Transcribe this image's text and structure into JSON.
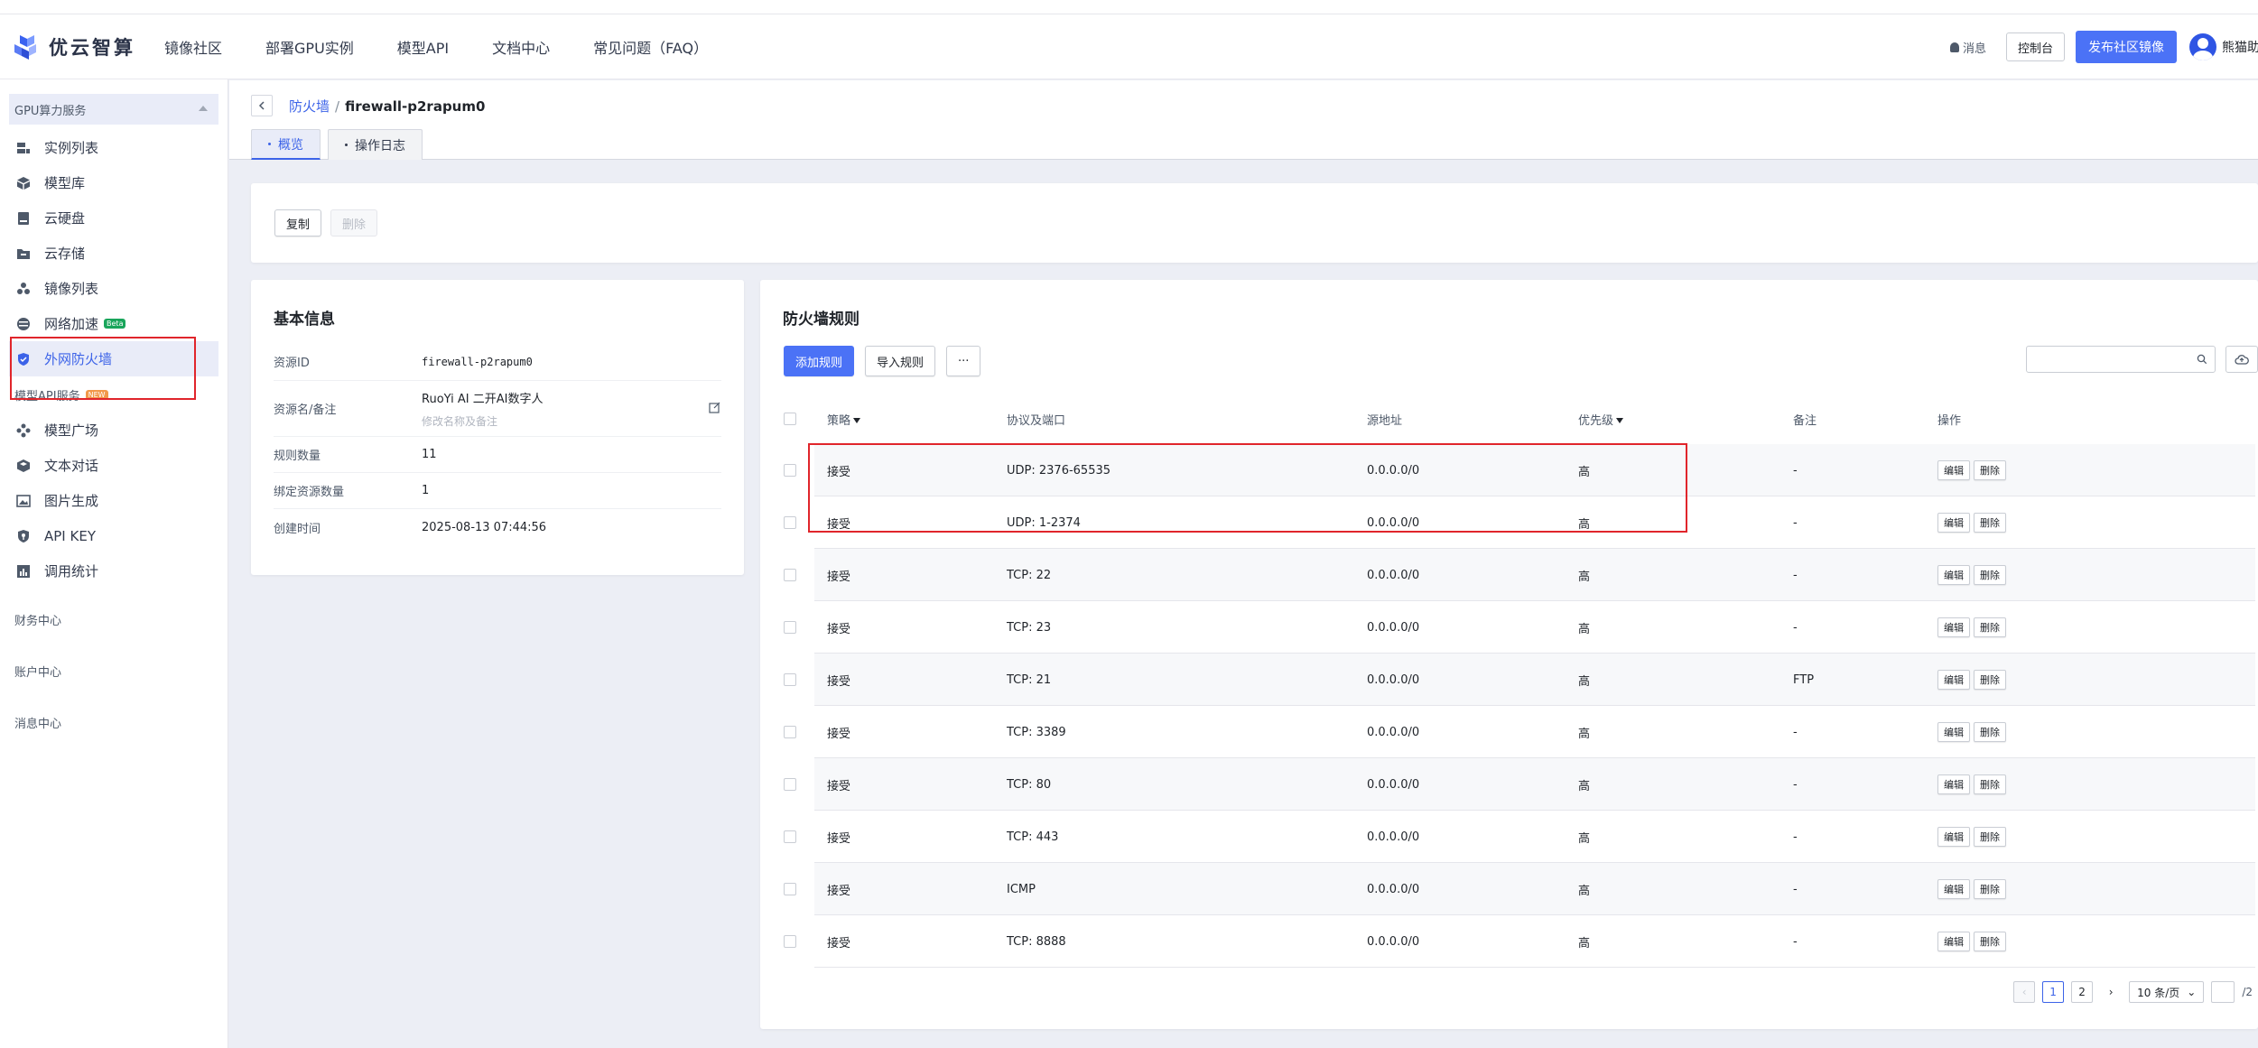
{
  "header": {
    "logo_text": "优云智算",
    "nav": [
      "镜像社区",
      "部署GPU实例",
      "模型API",
      "文档中心",
      "常见问题（FAQ）"
    ],
    "messages_label": "消息",
    "console_label": "控制台",
    "publish_label": "发布社区镜像",
    "username": "熊猫助手"
  },
  "sidebar": {
    "group1_label": "GPU算力服务",
    "group1_items": [
      {
        "label": "实例列表",
        "icon": "server-list-icon"
      },
      {
        "label": "模型库",
        "icon": "model-cube-icon"
      },
      {
        "label": "云硬盘",
        "icon": "disk-icon"
      },
      {
        "label": "云存储",
        "icon": "folder-icon"
      },
      {
        "label": "镜像列表",
        "icon": "image-stack-icon"
      },
      {
        "label": "网络加速",
        "icon": "network-icon",
        "badge": "Beta"
      },
      {
        "label": "外网防火墙",
        "icon": "shield-icon",
        "active": true
      }
    ],
    "group2_label": "模型API服务",
    "group2_badge": "NEW",
    "group2_items": [
      {
        "label": "模型广场",
        "icon": "grid-dots-icon"
      },
      {
        "label": "文本对话",
        "icon": "chat-cube-icon"
      },
      {
        "label": "图片生成",
        "icon": "picture-icon"
      },
      {
        "label": "API KEY",
        "icon": "key-shield-icon"
      },
      {
        "label": "调用统计",
        "icon": "bar-stats-icon"
      }
    ],
    "sections": [
      "财务中心",
      "账户中心",
      "消息中心"
    ]
  },
  "breadcrumb": {
    "parent": "防火墙",
    "separator": "/",
    "current": "firewall-p2rapum0"
  },
  "tabs": [
    "概览",
    "操作日志"
  ],
  "actions": {
    "copy_label": "复制",
    "delete_label": "删除"
  },
  "basic_info": {
    "title": "基本信息",
    "rows": [
      {
        "key": "资源ID",
        "value": "firewall-p2rapum0"
      },
      {
        "key": "资源名/备注",
        "value": "RuoYi AI 二开AI数字人",
        "sub": "修改名称及备注"
      },
      {
        "key": "规则数量",
        "value": "11"
      },
      {
        "key": "绑定资源数量",
        "value": "1"
      },
      {
        "key": "创建时间",
        "value": "2025-08-13 07:44:56"
      }
    ]
  },
  "rules": {
    "title": "防火墙规则",
    "add_label": "添加规则",
    "import_label": "导入规则",
    "more_label": "···",
    "search_placeholder": "",
    "columns": [
      "策略",
      "协议及端口",
      "源地址",
      "优先级",
      "备注",
      "操作"
    ],
    "edit_label": "编辑",
    "delete_label": "删除",
    "rows": [
      {
        "policy": "接受",
        "port": "UDP: 2376-65535",
        "source": "0.0.0.0/0",
        "priority": "高",
        "remark": "-"
      },
      {
        "policy": "接受",
        "port": "UDP: 1-2374",
        "source": "0.0.0.0/0",
        "priority": "高",
        "remark": "-"
      },
      {
        "policy": "接受",
        "port": "TCP: 22",
        "source": "0.0.0.0/0",
        "priority": "高",
        "remark": "-"
      },
      {
        "policy": "接受",
        "port": "TCP: 23",
        "source": "0.0.0.0/0",
        "priority": "高",
        "remark": "-"
      },
      {
        "policy": "接受",
        "port": "TCP: 21",
        "source": "0.0.0.0/0",
        "priority": "高",
        "remark": "FTP"
      },
      {
        "policy": "接受",
        "port": "TCP: 3389",
        "source": "0.0.0.0/0",
        "priority": "高",
        "remark": "-"
      },
      {
        "policy": "接受",
        "port": "TCP: 80",
        "source": "0.0.0.0/0",
        "priority": "高",
        "remark": "-"
      },
      {
        "policy": "接受",
        "port": "TCP: 443",
        "source": "0.0.0.0/0",
        "priority": "高",
        "remark": "-"
      },
      {
        "policy": "接受",
        "port": "ICMP",
        "source": "0.0.0.0/0",
        "priority": "高",
        "remark": "-"
      },
      {
        "policy": "接受",
        "port": "TCP: 8888",
        "source": "0.0.0.0/0",
        "priority": "高",
        "remark": "-"
      }
    ]
  },
  "pagination": {
    "pages": [
      "1",
      "2"
    ],
    "current": "1",
    "page_size": "10 条/页",
    "total_pages_label": "/2"
  },
  "colors": {
    "accent": "#4b72f6",
    "link": "#3c63e8",
    "highlight_box": "#e0252b"
  }
}
